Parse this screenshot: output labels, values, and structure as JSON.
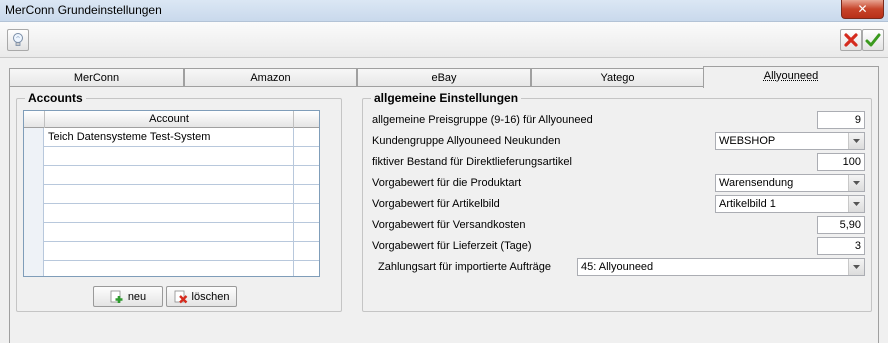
{
  "window": {
    "title": "MerConn Grundeinstellungen",
    "close_symbol": "✕"
  },
  "toolbar": {
    "left_icon": "lightbulb-icon",
    "right_icons": [
      "cancel-icon",
      "confirm-icon"
    ]
  },
  "tabs": [
    {
      "label": "MerConn",
      "active": false
    },
    {
      "label": "Amazon",
      "active": false
    },
    {
      "label": "eBay",
      "active": false
    },
    {
      "label": "Yatego",
      "active": false
    },
    {
      "label": "Allyouneed",
      "active": true
    }
  ],
  "accounts": {
    "title": "Accounts",
    "column_header": "Account",
    "rows": [
      "Teich Datensysteme Test-System",
      "",
      "",
      "",
      "",
      "",
      "",
      ""
    ],
    "new_button": "neu",
    "delete_button": "löschen"
  },
  "settings": {
    "title": "allgemeine Einstellungen",
    "price_group_label": "allgemeine Preisgruppe (9-16) für Allyouneed",
    "price_group_value": "9",
    "customer_group_label": "Kundengruppe Allyouneed Neukunden",
    "customer_group_value": "WEBSHOP",
    "stock_label": "fiktiver Bestand für Direktlieferungsartikel",
    "stock_value": "100",
    "product_type_label": "Vorgabewert für die Produktart",
    "product_type_value": "Warensendung",
    "article_image_label": "Vorgabewert für Artikelbild",
    "article_image_value": "Artikelbild 1",
    "shipping_cost_label": "Vorgabewert für Versandkosten",
    "shipping_cost_value": "5,90",
    "delivery_time_label": "Vorgabewert für Lieferzeit (Tage)",
    "delivery_time_value": "3",
    "payment_label": "Zahlungsart für importierte Aufträge",
    "payment_value": "45: Allyouneed"
  },
  "colors": {
    "title_bar": "#c9d9ec",
    "close_button": "#c7442a",
    "grid_border": "#7f9db9"
  }
}
